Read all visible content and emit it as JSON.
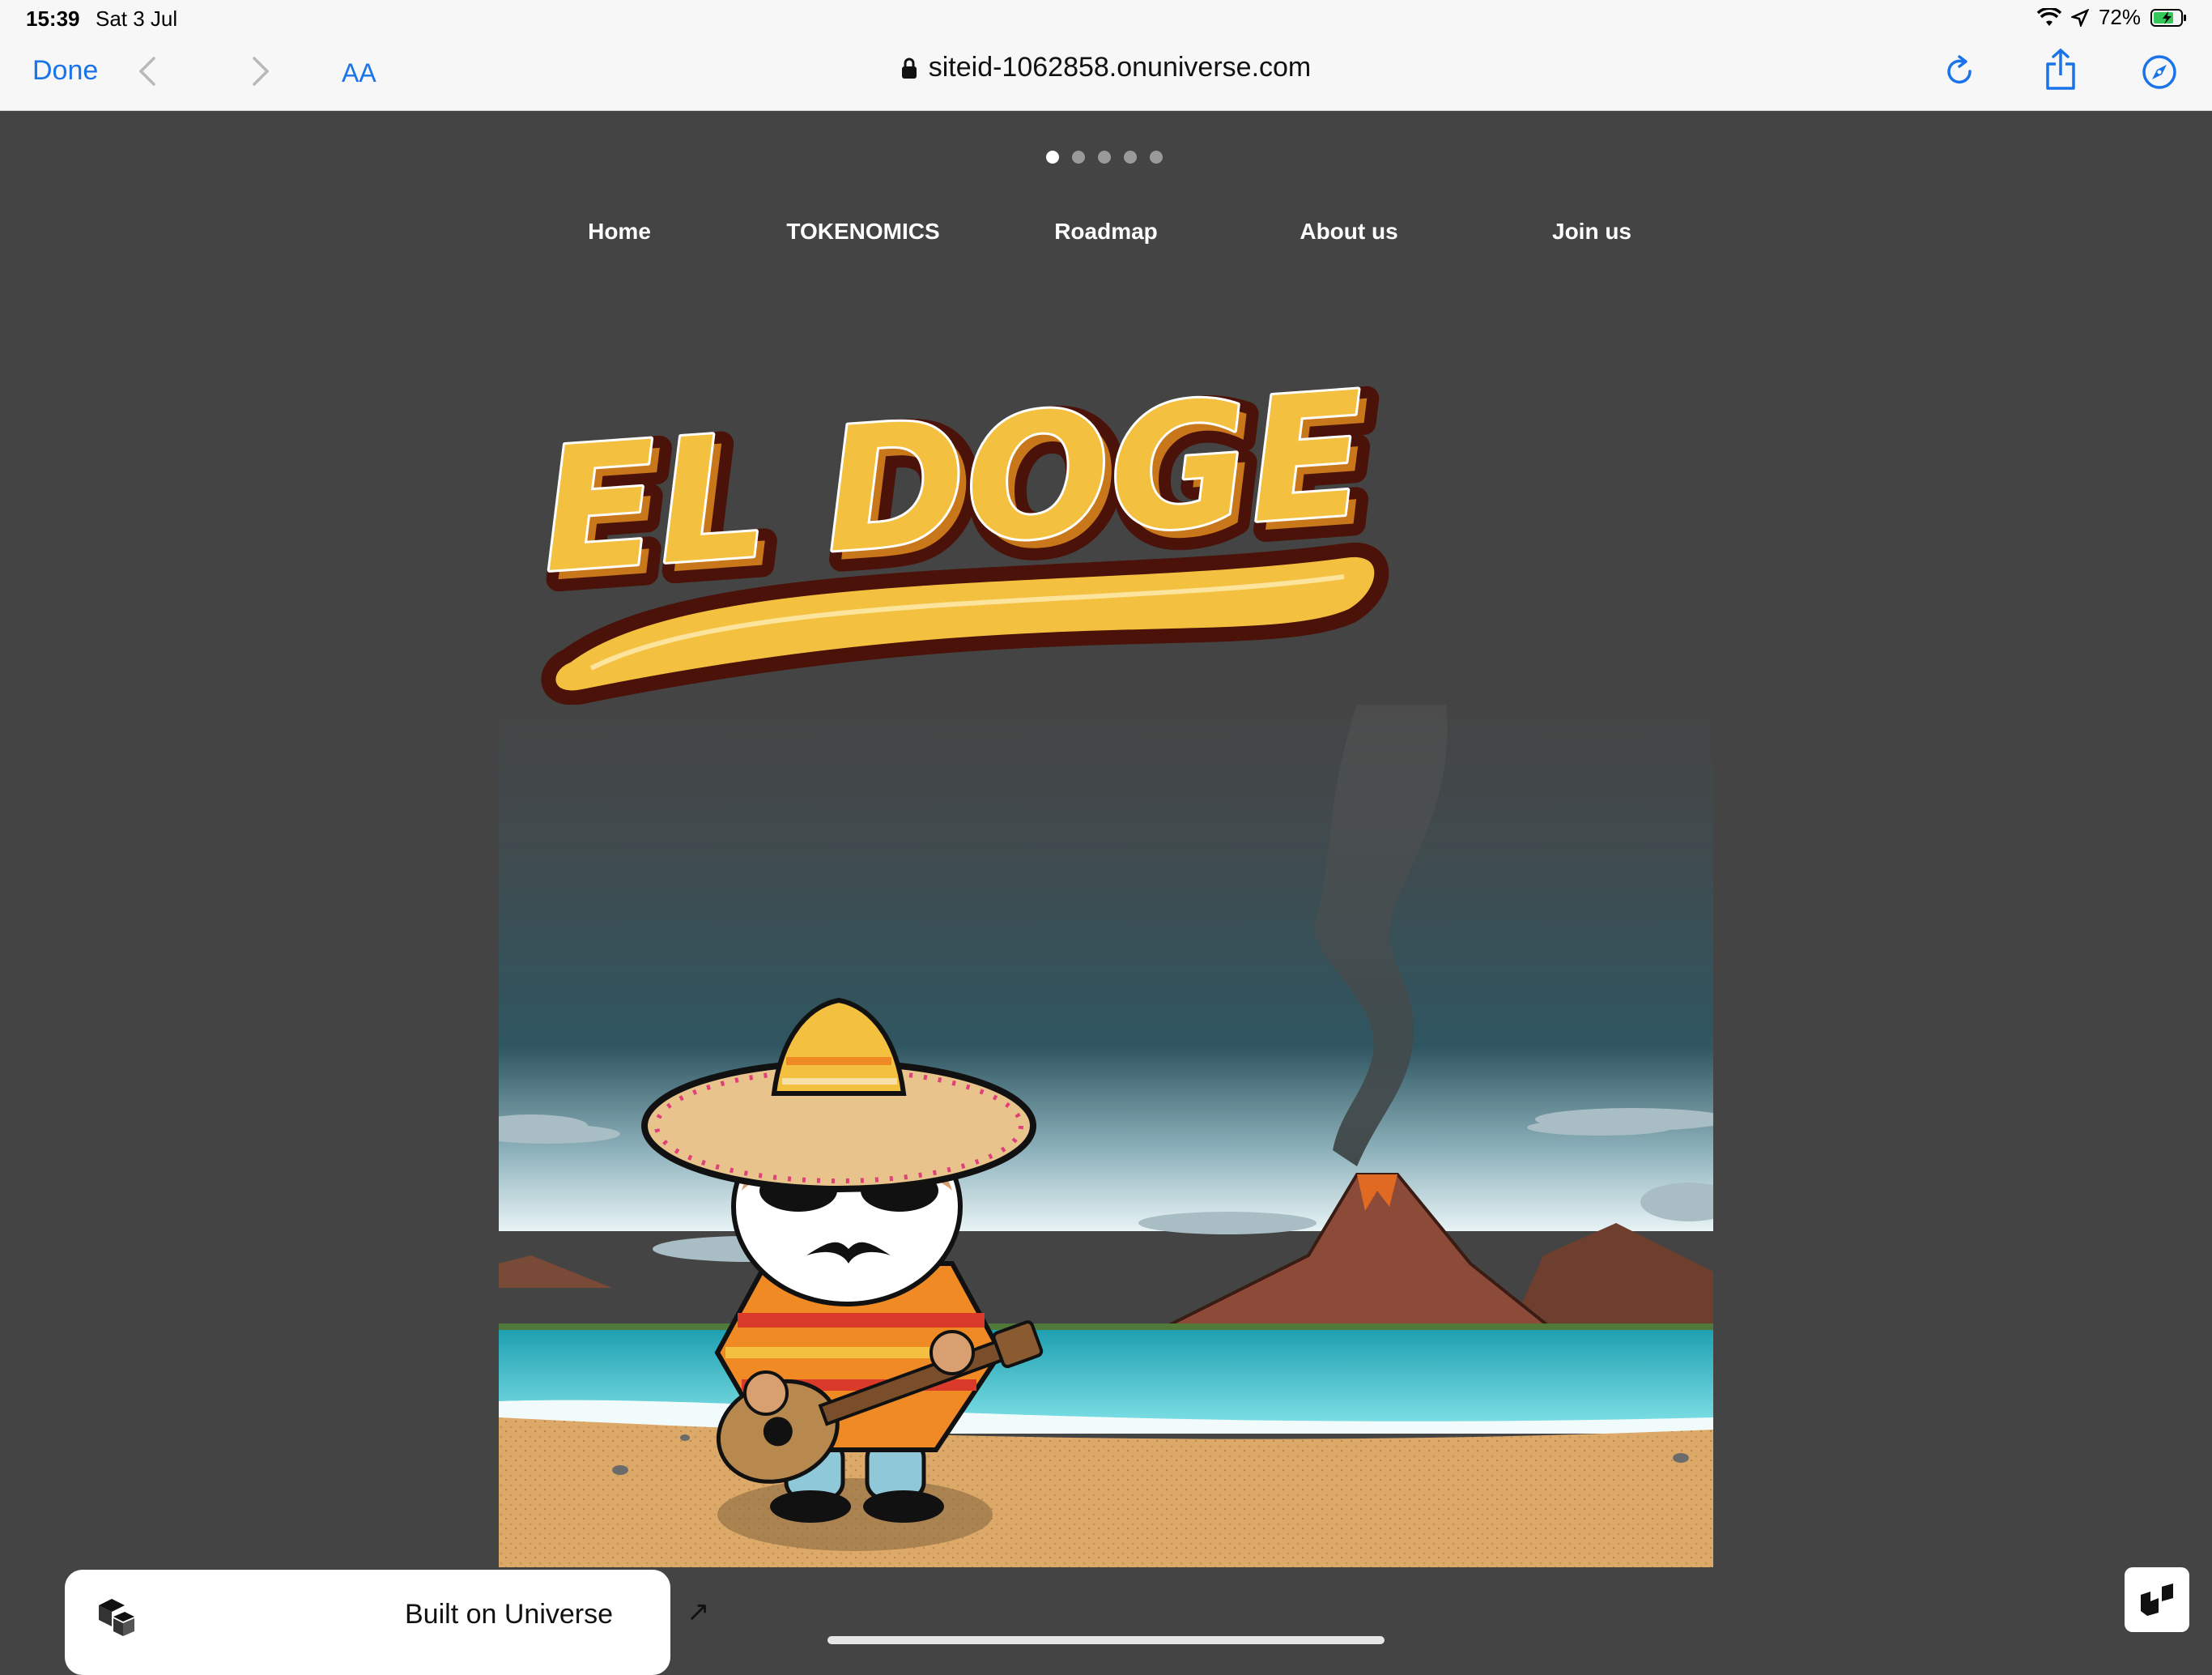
{
  "status": {
    "time": "15:39",
    "date": "Sat 3 Jul",
    "battery": "72%"
  },
  "toolbar": {
    "done": "Done",
    "text_size": "AA",
    "url": "siteid-1062858.onuniverse.com"
  },
  "carousel": {
    "dots": 5,
    "active": 0
  },
  "nav": {
    "items": [
      {
        "label": "Home"
      },
      {
        "label": "TOKENOMICS"
      },
      {
        "label": "Roadmap"
      },
      {
        "label": "About us"
      },
      {
        "label": "Join us"
      }
    ]
  },
  "logo": {
    "text": "EL DOGE"
  },
  "footer": {
    "built_on": "Built on Universe",
    "arrow": "↗"
  },
  "colors": {
    "accent": "#1a73e8",
    "page_bg": "#444444",
    "logo_fill": "#f4c040",
    "logo_outline": "#4a1208"
  },
  "icons": [
    "back-icon",
    "forward-icon",
    "reload-icon",
    "share-icon",
    "compass-icon",
    "lock-icon",
    "wifi-icon",
    "location-icon",
    "battery-icon",
    "universe-icon"
  ]
}
